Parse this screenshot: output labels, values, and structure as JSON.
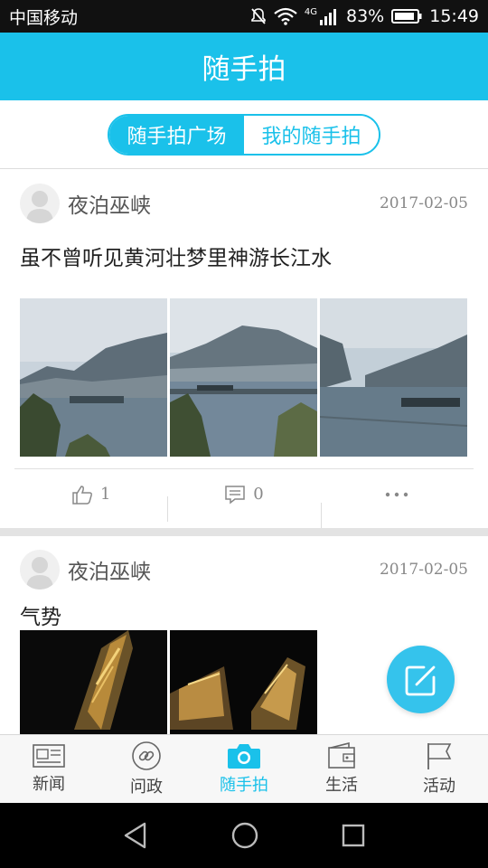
{
  "status_bar": {
    "carrier": "中国移动",
    "network": "4G",
    "battery": "83%",
    "time": "15:49"
  },
  "header": {
    "title": "随手拍"
  },
  "tabs": [
    {
      "label": "随手拍广场",
      "active": true
    },
    {
      "label": "我的随手拍",
      "active": false
    }
  ],
  "posts": [
    {
      "username": "夜泊巫峡",
      "date": "2017-02-05",
      "text": "虽不曾听见黄河壮梦里神游长江水",
      "image_count": 3,
      "likes": "1",
      "comments": "0"
    },
    {
      "username": "夜泊巫峡",
      "date": "2017-02-05",
      "text": "气势",
      "image_count": 2
    }
  ],
  "bottom_nav": [
    {
      "label": "新闻",
      "icon": "newspaper-icon",
      "active": false
    },
    {
      "label": "问政",
      "icon": "link-icon",
      "active": false
    },
    {
      "label": "随手拍",
      "icon": "camera-icon",
      "active": true
    },
    {
      "label": "生活",
      "icon": "wallet-icon",
      "active": false
    },
    {
      "label": "活动",
      "icon": "flag-icon",
      "active": false
    }
  ],
  "colors": {
    "accent": "#1ac1ea",
    "fab": "#35c3ec",
    "statusbar": "#111111"
  }
}
